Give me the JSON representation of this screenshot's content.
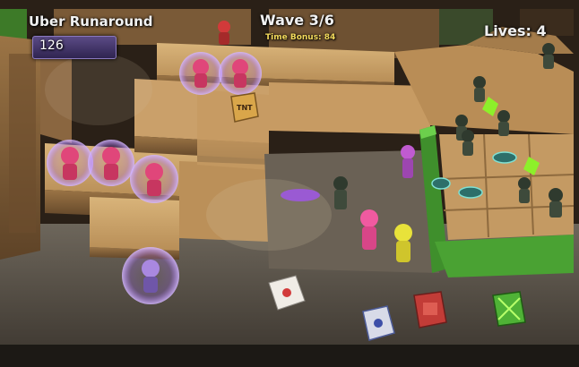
{
  "hud": {
    "level_name": "Uber Runaround",
    "score": "126",
    "wave": "Wave 3/6",
    "time_bonus": "Time Bonus: 84",
    "lives": "Lives: 4"
  },
  "scene": {
    "crate_label": "TNT",
    "colors": {
      "wood": "#c9a26b",
      "dark_wood": "#8a6640",
      "floor": "#5d564d",
      "green_wall": "#3f8f2c",
      "shield_glow": "#a56cff",
      "pink_unit": "#e0467a",
      "enemy": "#2f3a2e",
      "gem": "#8df02a"
    }
  }
}
